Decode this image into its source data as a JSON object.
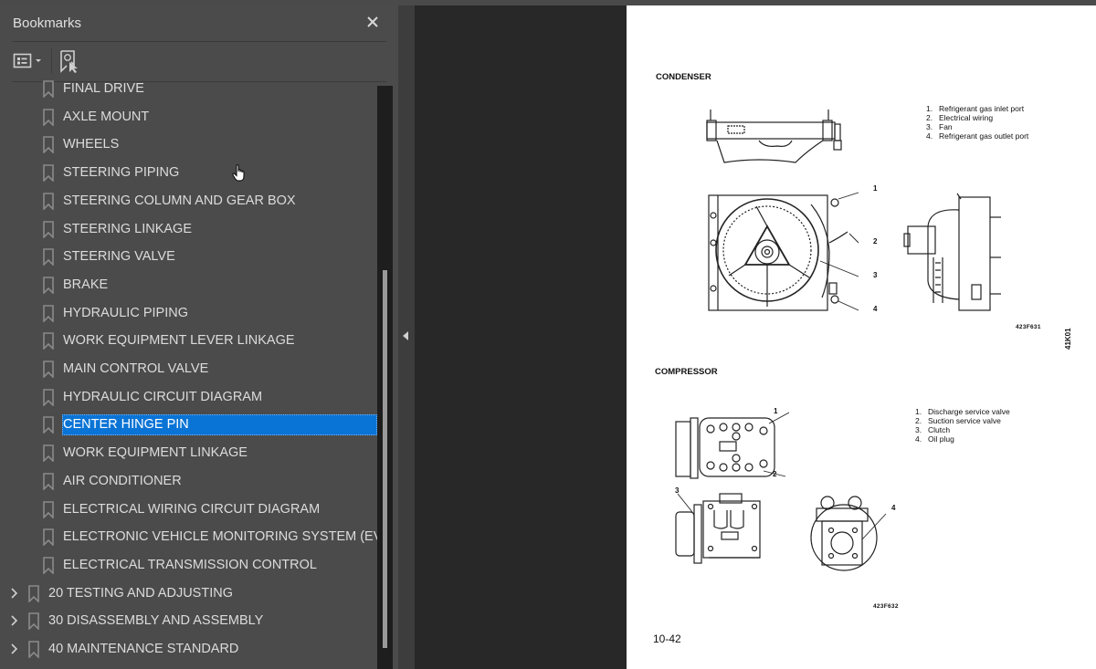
{
  "panel": {
    "title": "Bookmarks",
    "close_icon": "close-icon",
    "toolbar": {
      "options_icon": "list-options-icon",
      "find_icon": "find-current-bookmark-icon"
    }
  },
  "bookmarks": [
    {
      "label": "FINAL DRIVE",
      "level": 2,
      "selected": false
    },
    {
      "label": "AXLE MOUNT",
      "level": 2,
      "selected": false
    },
    {
      "label": "WHEELS",
      "level": 2,
      "selected": false
    },
    {
      "label": "STEERING PIPING",
      "level": 2,
      "selected": false
    },
    {
      "label": "STEERING COLUMN AND GEAR BOX",
      "level": 2,
      "selected": false
    },
    {
      "label": "STEERING LINKAGE",
      "level": 2,
      "selected": false
    },
    {
      "label": "STEERING VALVE",
      "level": 2,
      "selected": false
    },
    {
      "label": "BRAKE",
      "level": 2,
      "selected": false
    },
    {
      "label": "HYDRAULIC PIPING",
      "level": 2,
      "selected": false
    },
    {
      "label": "WORK EQUIPMENT LEVER LINKAGE",
      "level": 2,
      "selected": false
    },
    {
      "label": "MAIN CONTROL VALVE",
      "level": 2,
      "selected": false
    },
    {
      "label": "HYDRAULIC CIRCUIT DIAGRAM",
      "level": 2,
      "selected": false
    },
    {
      "label": "CENTER HINGE PIN",
      "level": 2,
      "selected": true
    },
    {
      "label": "WORK EQUIPMENT LINKAGE",
      "level": 2,
      "selected": false
    },
    {
      "label": "AIR CONDITIONER",
      "level": 2,
      "selected": false
    },
    {
      "label": "ELECTRICAL WIRING CIRCUIT DIAGRAM",
      "level": 2,
      "selected": false
    },
    {
      "label": "ELECTRONIC VEHICLE MONITORING SYSTEM (EVMS)",
      "level": 2,
      "selected": false
    },
    {
      "label": "ELECTRICAL TRANSMISSION CONTROL",
      "level": 2,
      "selected": false
    },
    {
      "label": "20 TESTING AND ADJUSTING",
      "level": 1,
      "selected": false,
      "expandable": true
    },
    {
      "label": "30 DISASSEMBLY AND ASSEMBLY",
      "level": 1,
      "selected": false,
      "expandable": true
    },
    {
      "label": "40 MAINTENANCE STANDARD",
      "level": 1,
      "selected": false,
      "expandable": true
    }
  ],
  "colors": {
    "selection": "#0a74d6",
    "panel_bg": "#4b4b4b",
    "viewer_bg": "#282828"
  },
  "document": {
    "condenser": {
      "heading": "CONDENSER",
      "legend": [
        {
          "n": "1.",
          "text": "Refrigerant gas inlet port"
        },
        {
          "n": "2.",
          "text": "Electrical wiring"
        },
        {
          "n": "3.",
          "text": "Fan"
        },
        {
          "n": "4.",
          "text": "Refrigerant gas outlet port"
        }
      ],
      "callouts": [
        "1",
        "2",
        "3",
        "4"
      ],
      "figure_code": "423F631"
    },
    "compressor": {
      "heading": "COMPRESSOR",
      "legend": [
        {
          "n": "1.",
          "text": "Discharge service valve"
        },
        {
          "n": "2.",
          "text": "Suction service valve"
        },
        {
          "n": "3.",
          "text": "Clutch"
        },
        {
          "n": "4.",
          "text": "Oil plug"
        }
      ],
      "callouts": [
        "1",
        "2",
        "3",
        "4"
      ],
      "figure_code": "423F632"
    },
    "side_code": "41K01",
    "page_number": "10-42"
  }
}
